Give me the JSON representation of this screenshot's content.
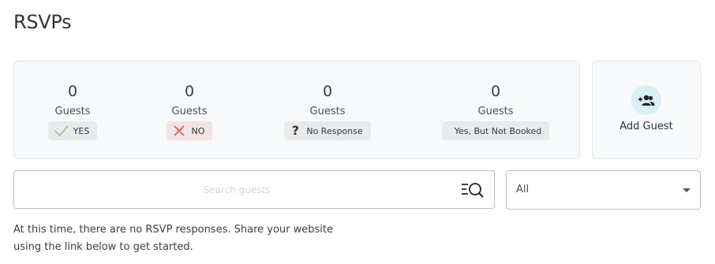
{
  "page": {
    "title": "RSVPs"
  },
  "stats": [
    {
      "count": "0",
      "label": "Guests",
      "badge": "YES",
      "icon": "check-icon"
    },
    {
      "count": "0",
      "label": "Guests",
      "badge": "NO",
      "icon": "x-icon"
    },
    {
      "count": "0",
      "label": "Guests",
      "badge": "No Response",
      "icon": "question-icon"
    },
    {
      "count": "0",
      "label": "Guests",
      "badge": "Yes, But Not Booked",
      "icon": ""
    }
  ],
  "add_guest": {
    "label": "Add Guest",
    "icon": "add-user-icon"
  },
  "search": {
    "placeholder": "Search guests",
    "value": "",
    "icon": "search-list-icon"
  },
  "filter": {
    "selected": "All"
  },
  "empty_message": "At this time, there are no RSVP responses. Share your website using the link below to get started.",
  "colors": {
    "check": "#8bc48a",
    "cross": "#e05a5a",
    "add_circle": "#d7eff5",
    "card_bg": "#f7f9fa"
  }
}
